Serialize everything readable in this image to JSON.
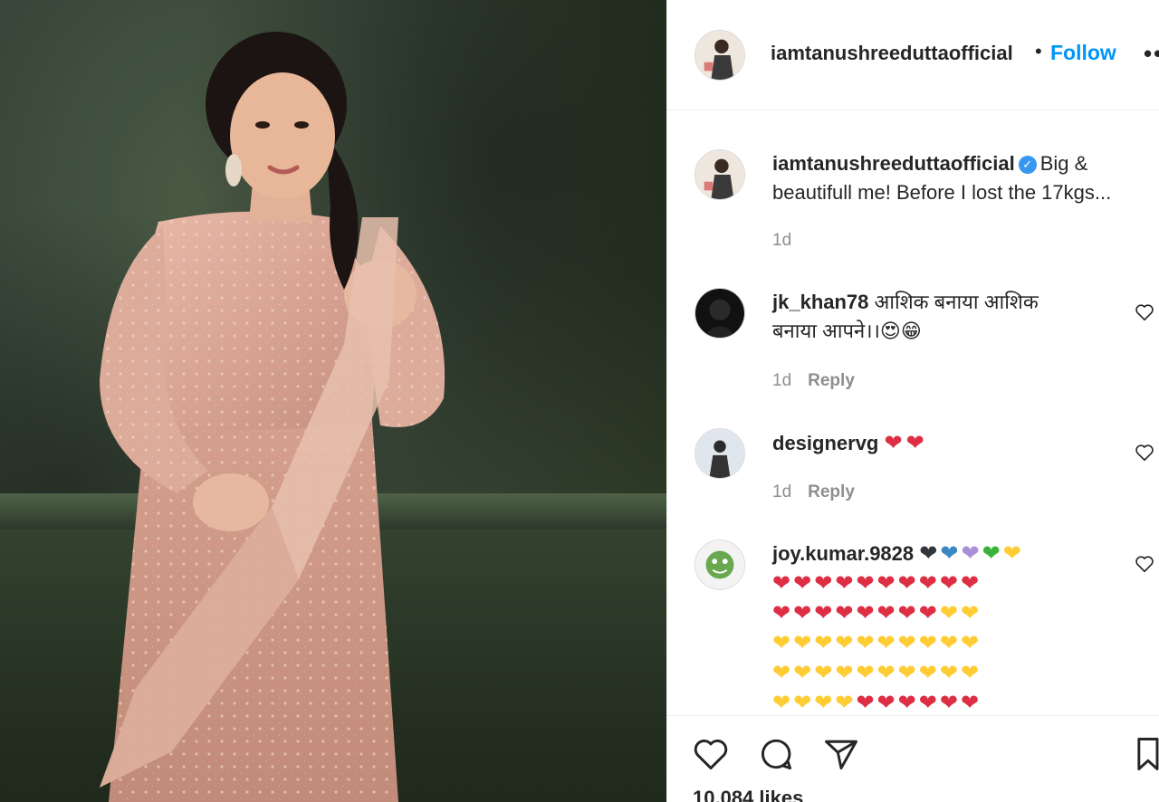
{
  "post": {
    "username": "iamtanushreeduttaofficial",
    "separator": "•",
    "follow_label": "Follow",
    "more_label": "••",
    "caption_text_line1": "Big &",
    "caption_text_line2": "beautifull me! Before I lost the 17kgs...",
    "caption_time": "1d",
    "verified_glyph": "✓",
    "likes": "10,084 likes"
  },
  "comments": [
    {
      "username": "jk_khan78",
      "text_line1": "आशिक बनाया आशिक",
      "text_line2": "बनाया आपने।।",
      "emojis": "😍😁",
      "time": "1d",
      "reply_label": "Reply"
    },
    {
      "username": "designervg",
      "hearts": "❤❤",
      "time": "1d",
      "reply_label": "Reply"
    },
    {
      "username": "joy.kumar.9828",
      "first_row": [
        "❤",
        "❤",
        "❤",
        "❤",
        "❤"
      ],
      "grid_rows": [
        [
          "❤",
          "❤",
          "❤",
          "❤",
          "❤",
          "❤",
          "❤",
          "❤",
          "❤",
          "❤"
        ],
        [
          "❤",
          "❤",
          "❤",
          "❤",
          "❤",
          "❤",
          "❤",
          "❤",
          "❤",
          "❤"
        ],
        [
          "❤",
          "❤",
          "❤",
          "❤",
          "❤",
          "❤",
          "❤",
          "❤",
          "❤",
          "❤"
        ],
        [
          "❤",
          "❤",
          "❤",
          "❤",
          "❤",
          "❤",
          "❤",
          "❤",
          "❤",
          "❤"
        ],
        [
          "❤",
          "❤",
          "❤",
          "❤",
          "❤",
          "❤",
          "❤",
          "❤",
          "❤",
          "❤"
        ]
      ]
    }
  ],
  "colors": {
    "follow_blue": "#0095f6",
    "verified_blue": "#3897f0",
    "meta_gray": "#8e8e8e",
    "text_dark": "#262626",
    "border": "#efefef",
    "heart_red": "#dd2e44",
    "heart_yellow": "#ffcc33",
    "heart_black": "#31373d",
    "heart_blue": "#3b88c3",
    "heart_purple": "#aa8ed6",
    "heart_green": "#3bb23b"
  },
  "icons": {
    "like": "heart-outline-icon",
    "comment": "comment-bubble-icon",
    "share": "paper-plane-icon",
    "save": "bookmark-icon",
    "comment_like": "small-heart-outline-icon"
  }
}
